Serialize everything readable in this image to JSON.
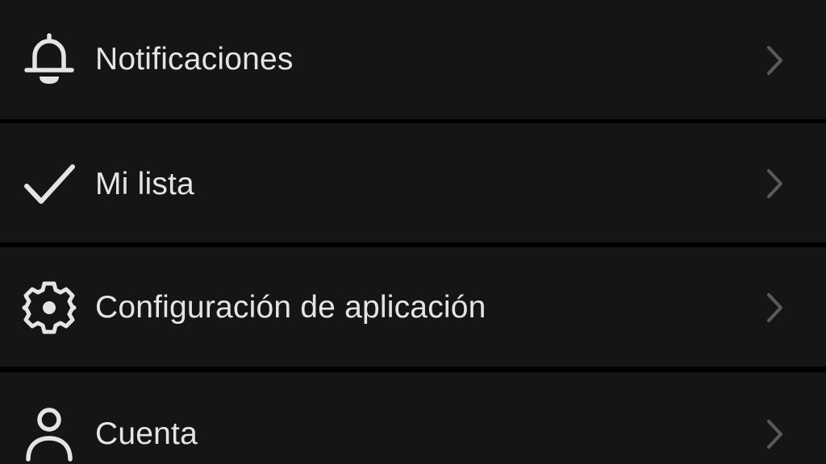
{
  "menu": {
    "items": [
      {
        "label": "Notificaciones",
        "icon": "bell-icon"
      },
      {
        "label": "Mi lista",
        "icon": "checkmark-icon"
      },
      {
        "label": "Configuración de aplicación",
        "icon": "gear-icon"
      },
      {
        "label": "Cuenta",
        "icon": "person-icon"
      }
    ]
  },
  "colors": {
    "background": "#000000",
    "row_background": "#151515",
    "text": "#e4e4e4",
    "icon": "#e4e4e4",
    "chevron": "#5a5a5a"
  }
}
